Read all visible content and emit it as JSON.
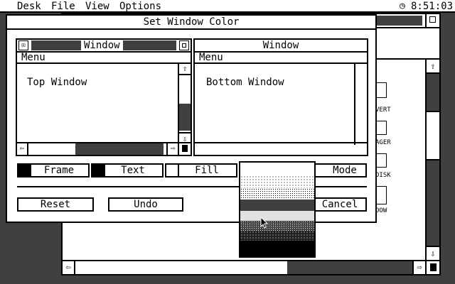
{
  "menubar": {
    "items": [
      "Desk",
      "File",
      "View",
      "Options"
    ],
    "clock": "8:51:03"
  },
  "dialog": {
    "title": "Set Window Color",
    "top_window": {
      "title": "Window",
      "menu": "Menu",
      "content": "Top Window"
    },
    "bottom_window": {
      "title": "Window",
      "menu": "Menu",
      "content": "Bottom Window"
    },
    "element_buttons": {
      "frame": "Frame",
      "text": "Text",
      "fill": "Fill",
      "mode": "Mode"
    },
    "buttons": {
      "reset": "Reset",
      "undo": "Undo",
      "cancel": "Cancel"
    }
  },
  "background_window": {
    "icons": [
      "VERT",
      "AGER",
      "DISK",
      "DOW"
    ]
  }
}
